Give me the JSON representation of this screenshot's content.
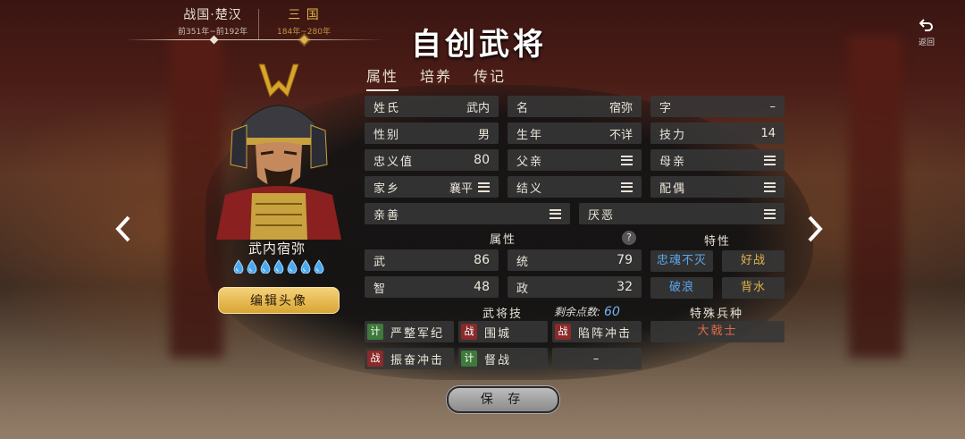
{
  "era": {
    "items": [
      {
        "name": "战国·楚汉",
        "years": "前351年~前192年"
      },
      {
        "name": "三 国",
        "years": "184年~280年"
      }
    ]
  },
  "title": "自创武将",
  "back_label": "返回",
  "tabs": [
    {
      "label": "属性",
      "active": true
    },
    {
      "label": "培养",
      "active": false
    },
    {
      "label": "传记",
      "active": false
    }
  ],
  "general": {
    "name": "武内宿弥",
    "stars": 7,
    "edit_portrait_label": "编辑头像"
  },
  "fields": {
    "surname": {
      "label": "姓氏",
      "value": "武内"
    },
    "given_name": {
      "label": "名",
      "value": "宿弥"
    },
    "courtesy": {
      "label": "字",
      "value": "–"
    },
    "gender": {
      "label": "性别",
      "value": "男"
    },
    "birth_year": {
      "label": "生年",
      "value": "不详"
    },
    "skill_power": {
      "label": "技力",
      "value": "14"
    },
    "loyalty": {
      "label": "忠义值",
      "value": "80"
    },
    "father": {
      "label": "父亲"
    },
    "mother": {
      "label": "母亲"
    },
    "hometown": {
      "label": "家乡",
      "value": "襄平"
    },
    "sworn": {
      "label": "结义"
    },
    "spouse": {
      "label": "配偶"
    },
    "friendly": {
      "label": "亲善"
    },
    "disliked": {
      "label": "厌恶"
    }
  },
  "attributes": {
    "header": "属性",
    "help": "?",
    "wu": {
      "label": "武",
      "value": "86"
    },
    "tong": {
      "label": "统",
      "value": "79"
    },
    "zhi": {
      "label": "智",
      "value": "48"
    },
    "zheng": {
      "label": "政",
      "value": "32"
    }
  },
  "traits": {
    "header": "特性",
    "items": [
      "忠魂不灭",
      "好战",
      "破浪",
      "背水"
    ]
  },
  "skills": {
    "header": "武将技",
    "remaining_label": "剩余点数:",
    "remaining_value": "60",
    "items": [
      {
        "tag": "计",
        "name": "严整军纪"
      },
      {
        "tag": "战",
        "name": "围城"
      },
      {
        "tag": "战",
        "name": "陷阵冲击"
      },
      {
        "tag": "战",
        "name": "振奋冲击"
      },
      {
        "tag": "计",
        "name": "督战"
      },
      {
        "tag": "",
        "name": "–"
      }
    ]
  },
  "special_troop": {
    "header": "特殊兵种",
    "value": "大戟士"
  },
  "save_label": "保 存",
  "colors": {
    "gold": "#e0b44a",
    "blue_trait": "#5aa8ef",
    "gold_trait": "#e3b34a",
    "special_troop": "#e0694a",
    "tag_ji": "#3e7a3a",
    "tag_zhan": "#8a2a2a"
  },
  "icons": {
    "back": "return-arrow-icon",
    "menu": "hamburger-menu-icon",
    "star": "water-drop-icon",
    "prev": "chevron-left-icon",
    "next": "chevron-right-icon"
  }
}
